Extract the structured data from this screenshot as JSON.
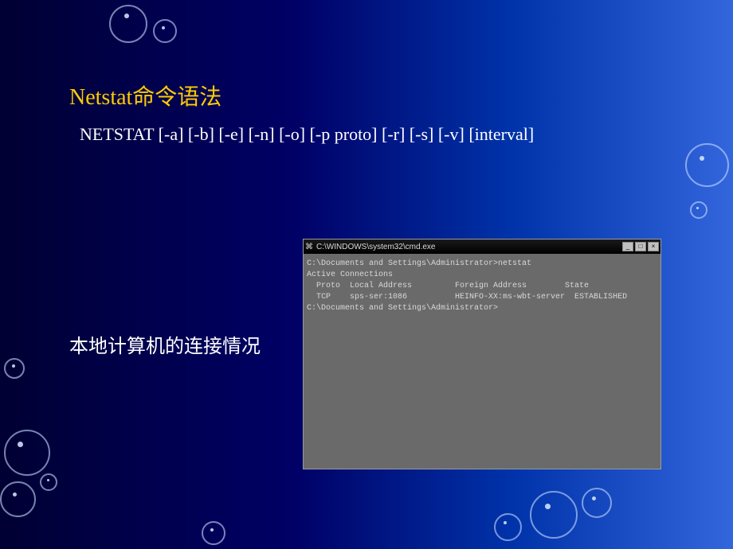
{
  "slide": {
    "title": "Netstat命令语法",
    "syntax": "NETSTAT [-a] [-b] [-e] [-n] [-o] [-p proto] [-r] [-s] [-v] [interval]",
    "label": "本地计算机的连接情况"
  },
  "terminal": {
    "windowTitle": "C:\\WINDOWS\\system32\\cmd.exe",
    "buttons": {
      "minimize": "_",
      "maximize": "□",
      "close": "×"
    },
    "line1": "C:\\Documents and Settings\\Administrator>netstat",
    "blank": "",
    "line2": "Active Connections",
    "header": "  Proto  Local Address         Foreign Address        State",
    "row1": "  TCP    sps-ser:1086          HEINFO-XX:ms-wbt-server  ESTABLISHED",
    "line3": "C:\\Documents and Settings\\Administrator>"
  }
}
